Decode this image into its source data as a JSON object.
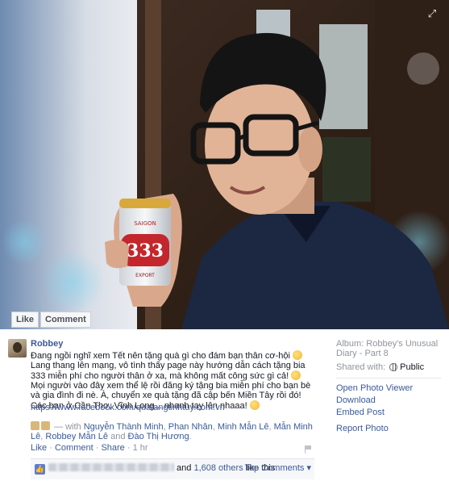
{
  "photo": {
    "expand_icon": "expand-arrows-icon",
    "actions": {
      "like_label": "Like",
      "comment_label": "Comment"
    },
    "can_text": {
      "brand": "SAIGON",
      "number": "333",
      "sub": "EXPORT"
    }
  },
  "post": {
    "author": "Robbey",
    "caption": [
      "Đang ngồi nghĩ xem Tết nên tặng quà gì cho đám bạn thân cơ-hội",
      " Lang thang lên mạng, vô tình thấy page này hướng dẫn cách tặng bia 333 miễn phí cho người thân ở xa, mà không mất công sức gì cả! ",
      " Mọi người vào đây xem thể lệ rồi đăng ký tặng bia miễn phí cho bạn bè và gia đình đi nè. À, chuyển xe quà tặng đã cập bến Miền Tây rồi đó! Các bạn ở Cần Thơ, Vĩnh Long... nhanh tay lên nhaaa! "
    ],
    "link": "https://www.facebook.com/quatangtinhtuy.com.vn",
    "tags": {
      "prefix": " — with ",
      "names": [
        "Nguyễn Thành Minh",
        "Phan Nhân",
        "Minh Mẫn Lê",
        "Mẫn Minh Lê",
        "Robbey Mẫn Lê"
      ],
      "conjunction": " and ",
      "last": "Đào Thị Hương",
      "end": "."
    },
    "actions": {
      "like": "Like",
      "comment": "Comment",
      "share": "Share",
      "time": "1 hr",
      "separator": " · "
    },
    "likes": {
      "others": "1,608 others",
      "middle": " and ",
      "suffix": " like this.",
      "top_comments": "Top Comments ▾"
    }
  },
  "side": {
    "album_prefix": "Album: ",
    "album_name": "Robbey's Unusual Diary - Part 8",
    "shared_label": "Shared with:",
    "privacy": "Public",
    "links": [
      "Open Photo Viewer",
      "Download",
      "Embed Post",
      "Report Photo"
    ]
  }
}
